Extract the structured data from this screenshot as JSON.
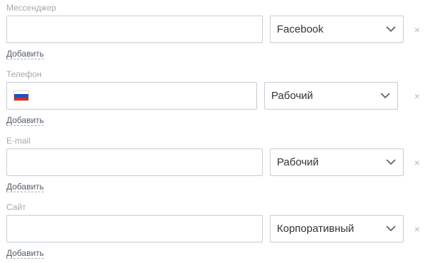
{
  "messenger": {
    "label": "Мессенджер",
    "value": "",
    "type": "Facebook",
    "remove": "×",
    "add": "Добавить"
  },
  "phone": {
    "label": "Телефон",
    "value": "",
    "flag": "russia-flag",
    "type": "Рабочий",
    "remove": "×",
    "add": "Добавить"
  },
  "email": {
    "label": "E-mail",
    "value": "",
    "type": "Рабочий",
    "remove": "×",
    "add": "Добавить"
  },
  "site": {
    "label": "Сайт",
    "value": "",
    "type": "Корпоративный",
    "remove": "×",
    "add": "Добавить"
  },
  "colors": {
    "border": "#c6cdd3",
    "label": "#a5a9ad",
    "link": "#535c69"
  }
}
